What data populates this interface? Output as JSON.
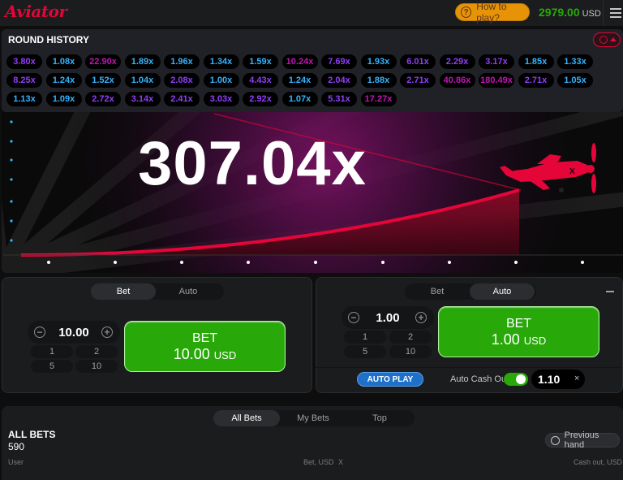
{
  "header": {
    "logo": "Aviator",
    "how_to_play": "How to play?",
    "balance": "2979.00",
    "currency": "USD"
  },
  "history": {
    "title": "ROUND HISTORY",
    "rows": [
      [
        "3.80x",
        "1.08x",
        "22.90x",
        "1.89x",
        "1.96x",
        "1.34x",
        "1.59x",
        "10.24x",
        "7.69x",
        "1.93x",
        "6.01x",
        "2.29x",
        "3.17x",
        "1.85x",
        "1.33x"
      ],
      [
        "8.25x",
        "1.24x",
        "1.52x",
        "1.04x",
        "2.08x",
        "1.00x",
        "4.43x",
        "1.24x",
        "2.04x",
        "1.88x",
        "2.71x",
        "40.86x",
        "180.49x",
        "2.71x",
        "1.05x"
      ],
      [
        "1.13x",
        "1.09x",
        "2.72x",
        "3.14x",
        "2.41x",
        "3.03x",
        "2.92x",
        "1.07x",
        "5.31x",
        "17.27x"
      ]
    ],
    "colors": {
      "blue": "#34b4ff",
      "purple": "#913ef8",
      "pink": "#c017b4"
    }
  },
  "game": {
    "multiplier": "307.04x",
    "curve_color": "#e50539"
  },
  "bet_panel_1": {
    "tab_bet": "Bet",
    "tab_auto": "Auto",
    "amount": "10.00",
    "minus": "−",
    "plus": "+",
    "quick": [
      "1",
      "2",
      "5",
      "10"
    ],
    "button_line1": "BET",
    "button_amount": "10.00",
    "button_currency": "USD"
  },
  "bet_panel_2": {
    "tab_bet": "Bet",
    "tab_auto": "Auto",
    "amount": "1.00",
    "minus": "−",
    "plus": "+",
    "quick": [
      "1",
      "2",
      "5",
      "10"
    ],
    "button_line1": "BET",
    "button_amount": "1.00",
    "button_currency": "USD",
    "auto_play": "AUTO PLAY",
    "auto_cash_out_label": "Auto Cash Out",
    "auto_cash_out_value": "1.10",
    "clear": "×"
  },
  "bets": {
    "tabs": [
      "All Bets",
      "My Bets",
      "Top"
    ],
    "title": "ALL BETS",
    "count": "590",
    "previous_hand": "Previous hand",
    "columns": {
      "user": "User",
      "bet": "Bet, USD",
      "x": "X",
      "cashout": "Cash out, USD"
    }
  }
}
